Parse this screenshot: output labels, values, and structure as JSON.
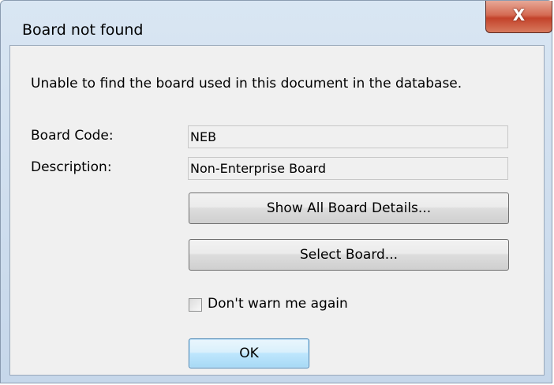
{
  "window": {
    "title": "Board not found",
    "close_glyph": "X"
  },
  "dialog": {
    "message": "Unable to find the board used in this document in the database.",
    "fields": [
      {
        "label": "Board Code:",
        "value": "NEB"
      },
      {
        "label": "Description:",
        "value": "Non-Enterprise Board"
      }
    ],
    "show_details_label": "Show All Board Details...",
    "select_board_label": "Select Board...",
    "dont_warn": {
      "label": "Don't warn me again",
      "checked": false
    },
    "ok_label": "OK"
  },
  "colors": {
    "frame": "#c6d7ea",
    "close_button": "#c3422a",
    "ok_button_border": "#3c7fb1"
  }
}
